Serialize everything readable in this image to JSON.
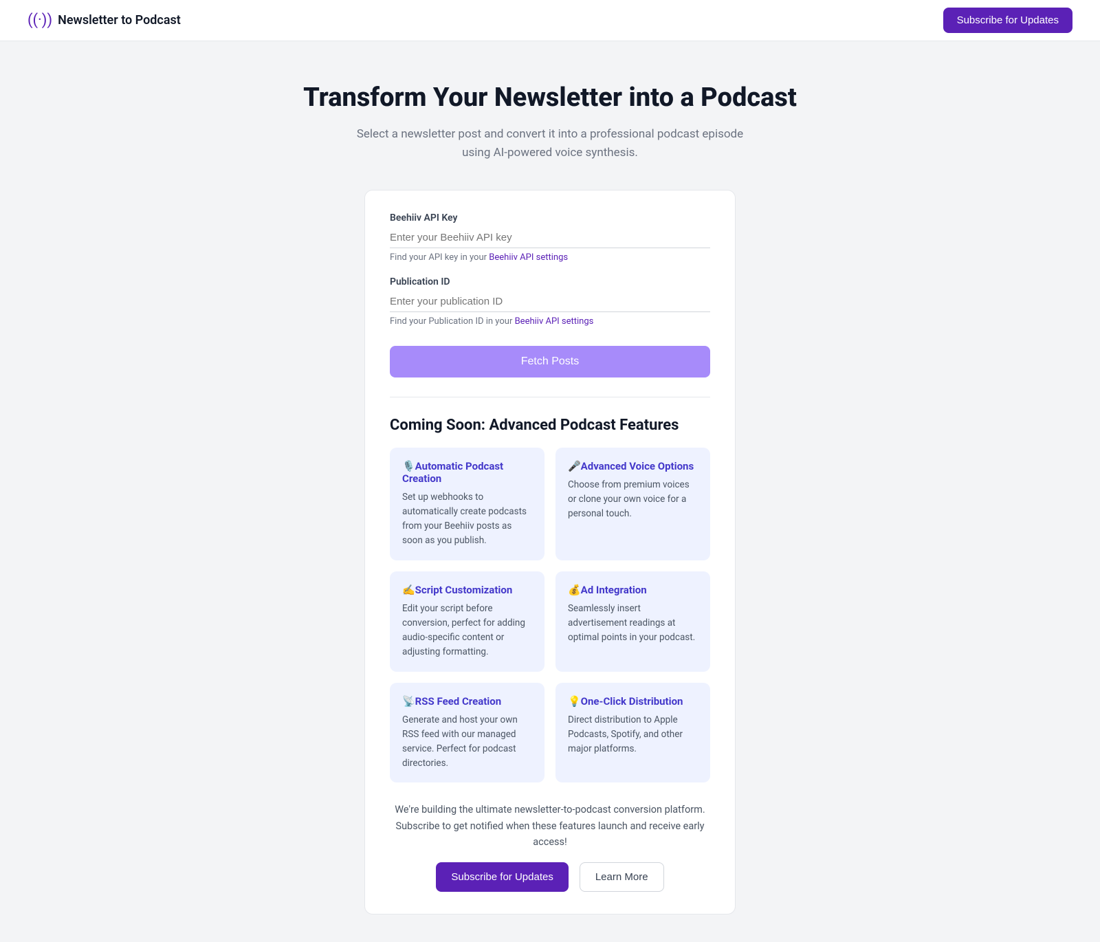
{
  "header": {
    "logo_icon": "((·))",
    "logo_text": "Newsletter to Podcast",
    "subscribe_button_label": "Subscribe for Updates"
  },
  "hero": {
    "title": "Transform Your Newsletter into a Podcast",
    "subtitle": "Select a newsletter post and convert it into a professional podcast episode using AI-powered voice synthesis."
  },
  "form": {
    "api_key_label": "Beehiiv API Key",
    "api_key_placeholder": "Enter your Beehiiv API key",
    "api_key_hint_prefix": "Find your API key in your ",
    "api_key_hint_link": "Beehiiv API settings",
    "publication_id_label": "Publication ID",
    "publication_id_placeholder": "Enter your publication ID",
    "publication_id_hint_prefix": "Find your Publication ID in your ",
    "publication_id_hint_link": "Beehiiv API settings",
    "fetch_button_label": "Fetch Posts"
  },
  "coming_soon": {
    "title": "Coming Soon: Advanced Podcast Features",
    "features": [
      {
        "icon": "🎙️",
        "title": "Automatic Podcast Creation",
        "description": "Set up webhooks to automatically create podcasts from your Beehiiv posts as soon as you publish."
      },
      {
        "icon": "🎤",
        "title": "Advanced Voice Options",
        "description": "Choose from premium voices or clone your own voice for a personal touch."
      },
      {
        "icon": "✍️",
        "title": "Script Customization",
        "description": "Edit your script before conversion, perfect for adding audio-specific content or adjusting formatting."
      },
      {
        "icon": "💰",
        "title": "Ad Integration",
        "description": "Seamlessly insert advertisement readings at optimal points in your podcast."
      },
      {
        "icon": "📡",
        "title": "RSS Feed Creation",
        "description": "Generate and host your own RSS feed with our managed service. Perfect for podcast directories."
      },
      {
        "icon": "💡",
        "title": "One-Click Distribution",
        "description": "Direct distribution to Apple Podcasts, Spotify, and other major platforms."
      }
    ]
  },
  "footer": {
    "text": "We're building the ultimate newsletter-to-podcast conversion platform. Subscribe to get notified when these features launch and receive early access!",
    "primary_button": "Subscribe for Updates",
    "secondary_button": "Learn More"
  }
}
